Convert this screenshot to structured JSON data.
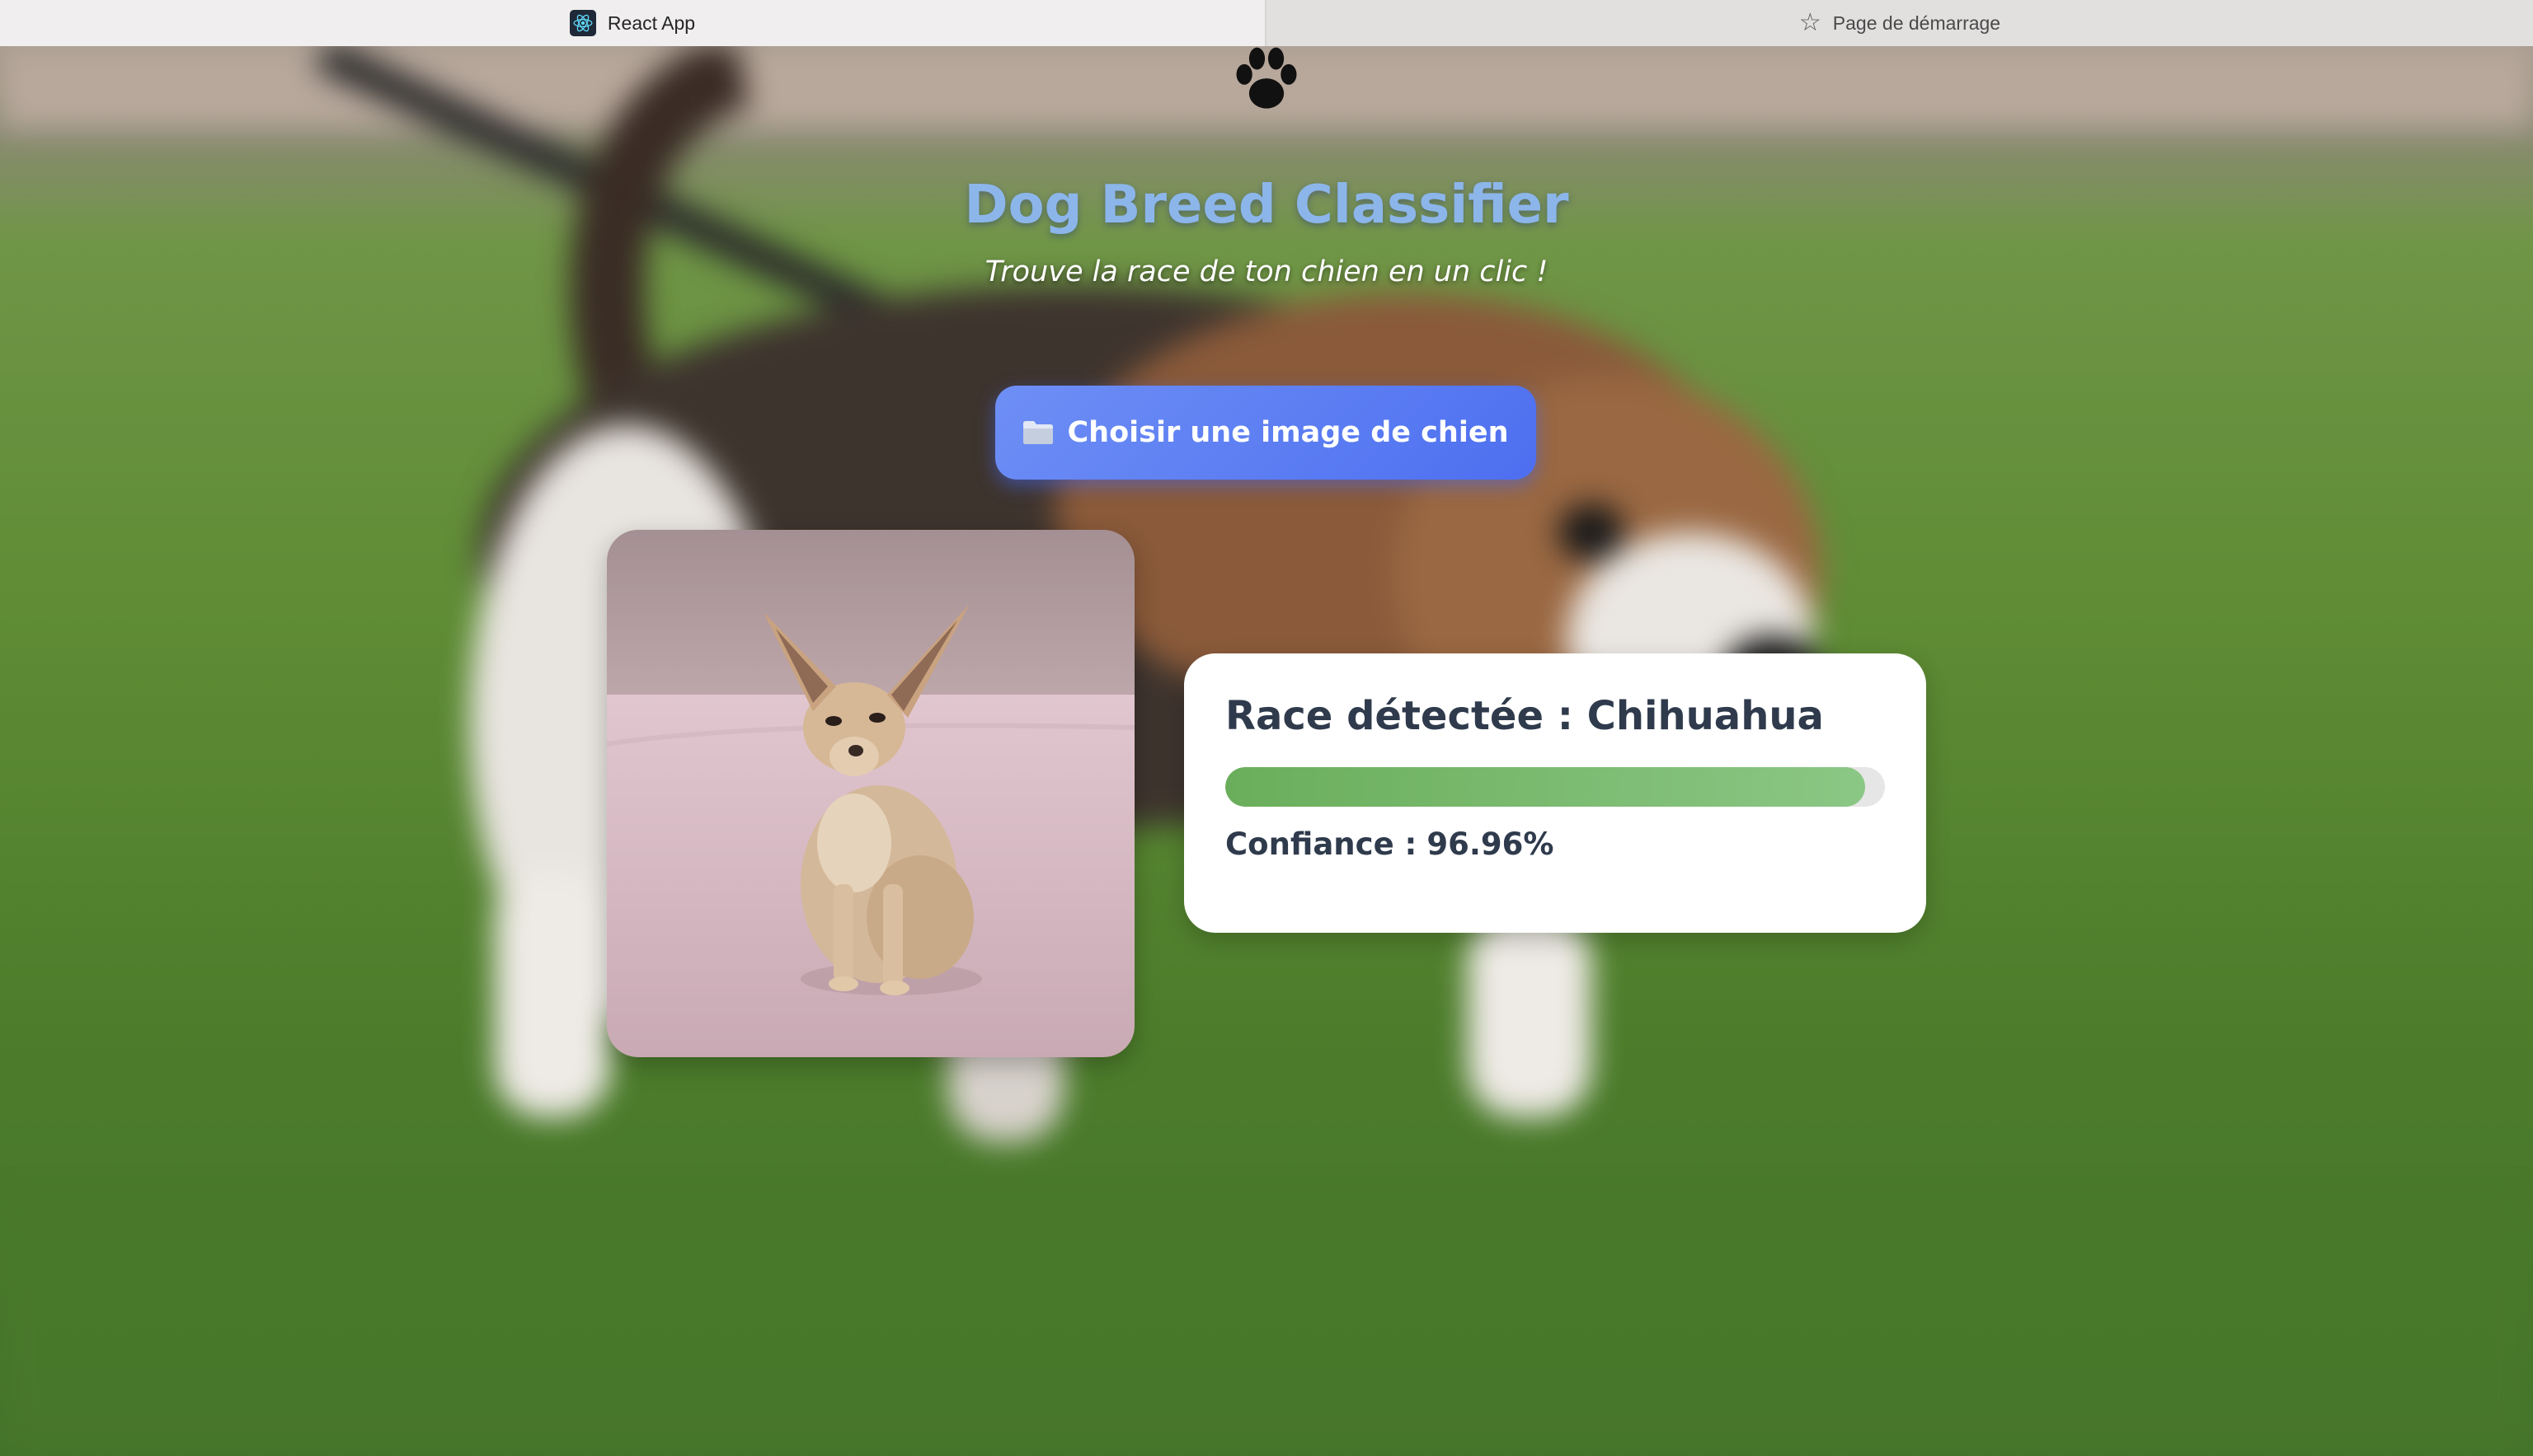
{
  "browser": {
    "tabs": [
      {
        "label": "React App",
        "icon": "react-icon",
        "active": true
      },
      {
        "label": "Page de démarrage",
        "icon": "star-icon",
        "active": false
      }
    ]
  },
  "header": {
    "icon": "paw-icon",
    "title": "Dog Breed Classifier",
    "subtitle": "Trouve la race de ton chien en un clic !"
  },
  "upload": {
    "icon": "folder-icon",
    "label": "Choisir une image de chien"
  },
  "result": {
    "title": "Race détectée : Chihuahua",
    "confidence_label": "Confiance :",
    "confidence_value": "96.96%",
    "confidence_fraction": 0.9696
  },
  "colors": {
    "accent_button": "#5a7cf2",
    "title": "#8cb6ea",
    "progress": "#74b46a",
    "card_text": "#2f3b4c"
  }
}
